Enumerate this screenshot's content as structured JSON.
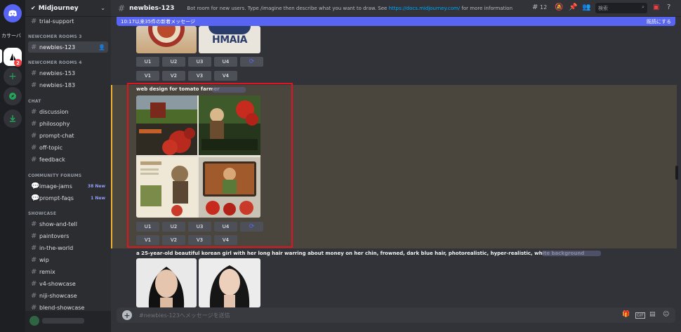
{
  "server_rail": {
    "label": "カサーバ",
    "badge": "2"
  },
  "sidebar": {
    "server_name": "Midjourney",
    "channels_top": [
      {
        "label": "trial-support"
      }
    ],
    "cat1": "NEWCOMER ROOMS 3",
    "active_channel": "newbies-123",
    "cat2": "NEWCOMER ROOMS 4",
    "newcomer4": [
      "newbies-153",
      "newbies-183"
    ],
    "cat3": "CHAT",
    "chat": [
      "discussion",
      "philosophy",
      "prompt-chat",
      "off-topic",
      "feedback"
    ],
    "cat4": "COMMUNITY FORUMS",
    "forums": [
      {
        "label": "image-jams",
        "badge": "38 New"
      },
      {
        "label": "prompt-faqs",
        "badge": "1 New"
      }
    ],
    "cat5": "SHOWCASE",
    "showcase": [
      "show-and-tell",
      "paintovers",
      "in-the-world",
      "wip",
      "remix",
      "v4-showcase",
      "niji-showcase",
      "blend-showcase"
    ]
  },
  "topbar": {
    "channel": "newbies-123",
    "topic_pre": "Bot room for new users. Type /imagine then describe what you want to draw. See ",
    "topic_link": "https://docs.midjourney.com/",
    "topic_post": " for more information",
    "member_count": "12",
    "search_placeholder": "検索"
  },
  "new_messages_bar": {
    "text": "10:17以来35件の新着メッセージ",
    "mark_read": "既読にする"
  },
  "messages": [
    {
      "buttons_u": [
        "U1",
        "U2",
        "U3",
        "U4"
      ],
      "buttons_v": [
        "V1",
        "V2",
        "V3",
        "V4"
      ],
      "logo_text": "HMAIA"
    },
    {
      "title": "web design for tomato farmer",
      "buttons_u": [
        "U1",
        "U2",
        "U3",
        "U4"
      ],
      "buttons_v": [
        "V1",
        "V2",
        "V3",
        "V4"
      ]
    },
    {
      "title": "a 25-year-old beautiful korean girl with her long hair warring about money on her chin, frowned, dark blue hair, photorealistic, hyper-realistic, white background"
    }
  ],
  "composer": {
    "placeholder": "#newbies-123へメッセージを送信"
  },
  "icons": {
    "refresh": "⟳",
    "hash": "#"
  }
}
